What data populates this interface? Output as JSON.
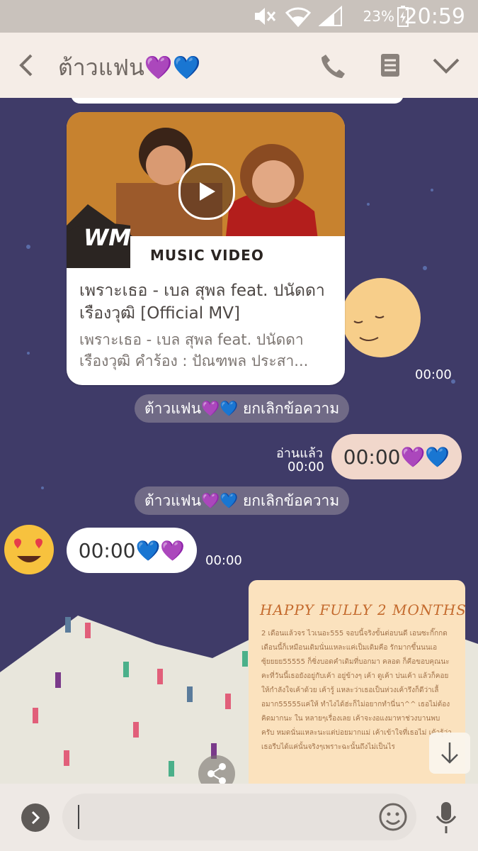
{
  "status_bar": {
    "battery_percent": "23%",
    "time": "20:59",
    "icons": [
      "mute-icon",
      "wifi-icon",
      "signal-icon",
      "battery-icon"
    ]
  },
  "header": {
    "title": "ต้าวแฟน💜💙",
    "icons": [
      "back-icon",
      "phone-icon",
      "notes-icon",
      "chevron-down-icon"
    ]
  },
  "messages": {
    "video_card": {
      "overlay_label": "MUSIC VIDEO",
      "title": "เพราะเธอ - เบล สุพล feat. ปนัดดา เรืองวุฒิ [Official MV]",
      "description": "เพราะเธอ - เบล สุพล feat. ปนัดดา เรืองวุฒิ คำร้อง : ปัณฑพล ประสา...",
      "time": "00:00"
    },
    "system_1": "ต้าวแฟน💜💙 ยกเลิกข้อความ",
    "outgoing": {
      "text": "00:00💜💙",
      "read_label": "อ่านแล้ว",
      "time": "00:00"
    },
    "system_2": "ต้าวแฟน💜💙 ยกเลิกข้อความ",
    "incoming": {
      "text": "00:00💙💜",
      "time": "00:00"
    },
    "letter_card": {
      "title": "HAPPY FULLY 2 MONTHS",
      "body": "2 เดือนแล้วจร ไวเนอะ555 จอบนี้จริงขั้นต่อบนดี เอนซะกิ๊กกด เดือนนี้ก็เหมือนเดิมนั่นแหละแค่เป็มเดิมคือ รักมากขึ้นนนเอซุ้ยยยย55555 ก็ซิ่งบอดคำเดิมที่บอกมา คลอด ก็คือขอบคุณนะคะที่วันนี้เธอยังอยู่กับเค้า อยู่ข้างๆ เค้า ดูเค้า บ่นเค้า แล้วก็คอยให้กำลังใจเค้าด้วย เค้ารู้ แหละว่าเธอเป็นห่วงเค้ารึงก็ดีว่าเลื้อมาก55555แค่ให้ ทำไงได้ฮ่ะก็ไม่อยากทำนี่นา^^ เธอไม่ต้องคิดมากนะ ใน หลายๆเรื่องเลย เค้าจะงอแงมาหาช่วงบานพบครับ หมดนั่นแหละนะแต่บ่อยมากแม่ เค้าเข้าใจที่เธอไม่ เค้ารู้ว่าเธอรีบได้แค่นั้นจริงๆเพราะฉะนั้นถึงไม่เป็นไร"
    }
  },
  "composer": {
    "placeholder": "",
    "icons": [
      "expand-icon",
      "emoji-icon",
      "microphone-icon"
    ]
  }
}
